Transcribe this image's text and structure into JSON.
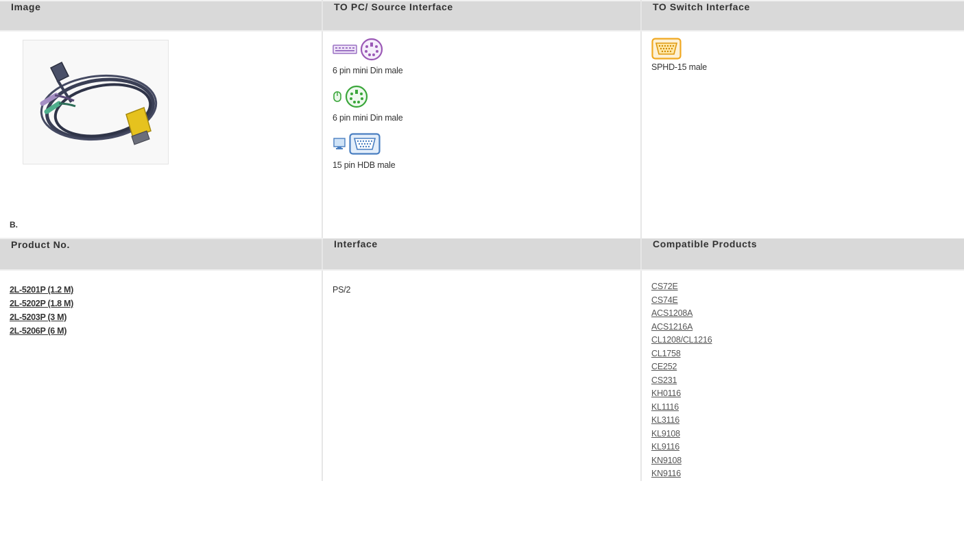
{
  "headers": {
    "image": "Image",
    "to_pc": "TO PC/ Source Interface",
    "to_switch": "TO Switch Interface",
    "product_no": "Product No.",
    "interface": "Interface",
    "compatible": "Compatible Products"
  },
  "image_cell": {
    "label": "B.",
    "photo_icon": "kvm-cable-photo"
  },
  "pc_interfaces": [
    {
      "icons": [
        "keyboard-icon",
        "ps2-port-purple-icon"
      ],
      "text": "6 pin mini Din male"
    },
    {
      "icons": [
        "mouse-icon",
        "ps2-port-green-icon"
      ],
      "text": "6 pin mini Din male"
    },
    {
      "icons": [
        "monitor-icon",
        "vga-port-blue-icon"
      ],
      "text": "15 pin HDB male"
    }
  ],
  "switch_interface": {
    "icon": "sphd-port-yellow-icon",
    "text": "SPHD-15 male"
  },
  "product_numbers": [
    "2L-5201P (1.2 M)",
    "2L-5202P (1.8 M)",
    "2L-5203P (3 M)",
    "2L-5206P (6 M)"
  ],
  "interface_value": "PS/2",
  "compatible_products": [
    "CS72E",
    "CS74E",
    "ACS1208A",
    "ACS1216A",
    "CL1208/CL1216",
    "CL1758",
    "CE252",
    "CS231",
    "KH0116",
    "KL1116",
    "KL3116",
    "KL9108",
    "KL9116",
    "KN9108",
    "KN9116"
  ],
  "colors": {
    "header_bg": "#d9d9d9",
    "purple": "#9b59b6",
    "green": "#3aa63a",
    "blue": "#4a7fc1",
    "yellow": "#f0a820"
  }
}
